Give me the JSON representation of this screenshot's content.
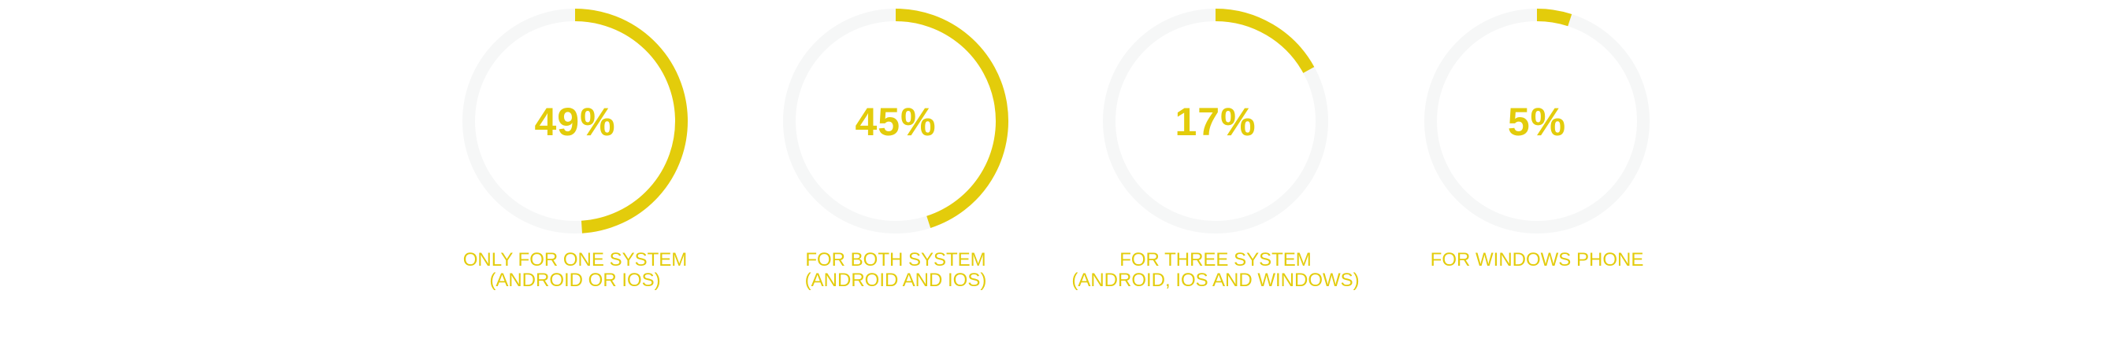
{
  "colors": {
    "accent": "#E3CC0B",
    "track": "#F6F7F7",
    "background": "#FFFFFF"
  },
  "chart_data": [
    {
      "type": "donut",
      "value": 49,
      "max": 100,
      "center_label": "49%",
      "caption_lines": [
        "ONLY FOR ONE SYSTEM",
        "(ANDROID OR IOS)"
      ]
    },
    {
      "type": "donut",
      "value": 45,
      "max": 100,
      "center_label": "45%",
      "caption_lines": [
        "FOR BOTH SYSTEM",
        "(ANDROID AND IOS)"
      ]
    },
    {
      "type": "donut",
      "value": 17,
      "max": 100,
      "center_label": "17%",
      "caption_lines": [
        "FOR THREE SYSTEM",
        "(ANDROID, IOS AND WINDOWS)"
      ]
    },
    {
      "type": "donut",
      "value": 5,
      "max": 100,
      "center_label": "5%",
      "caption_lines": [
        "FOR WINDOWS PHONE"
      ]
    }
  ]
}
